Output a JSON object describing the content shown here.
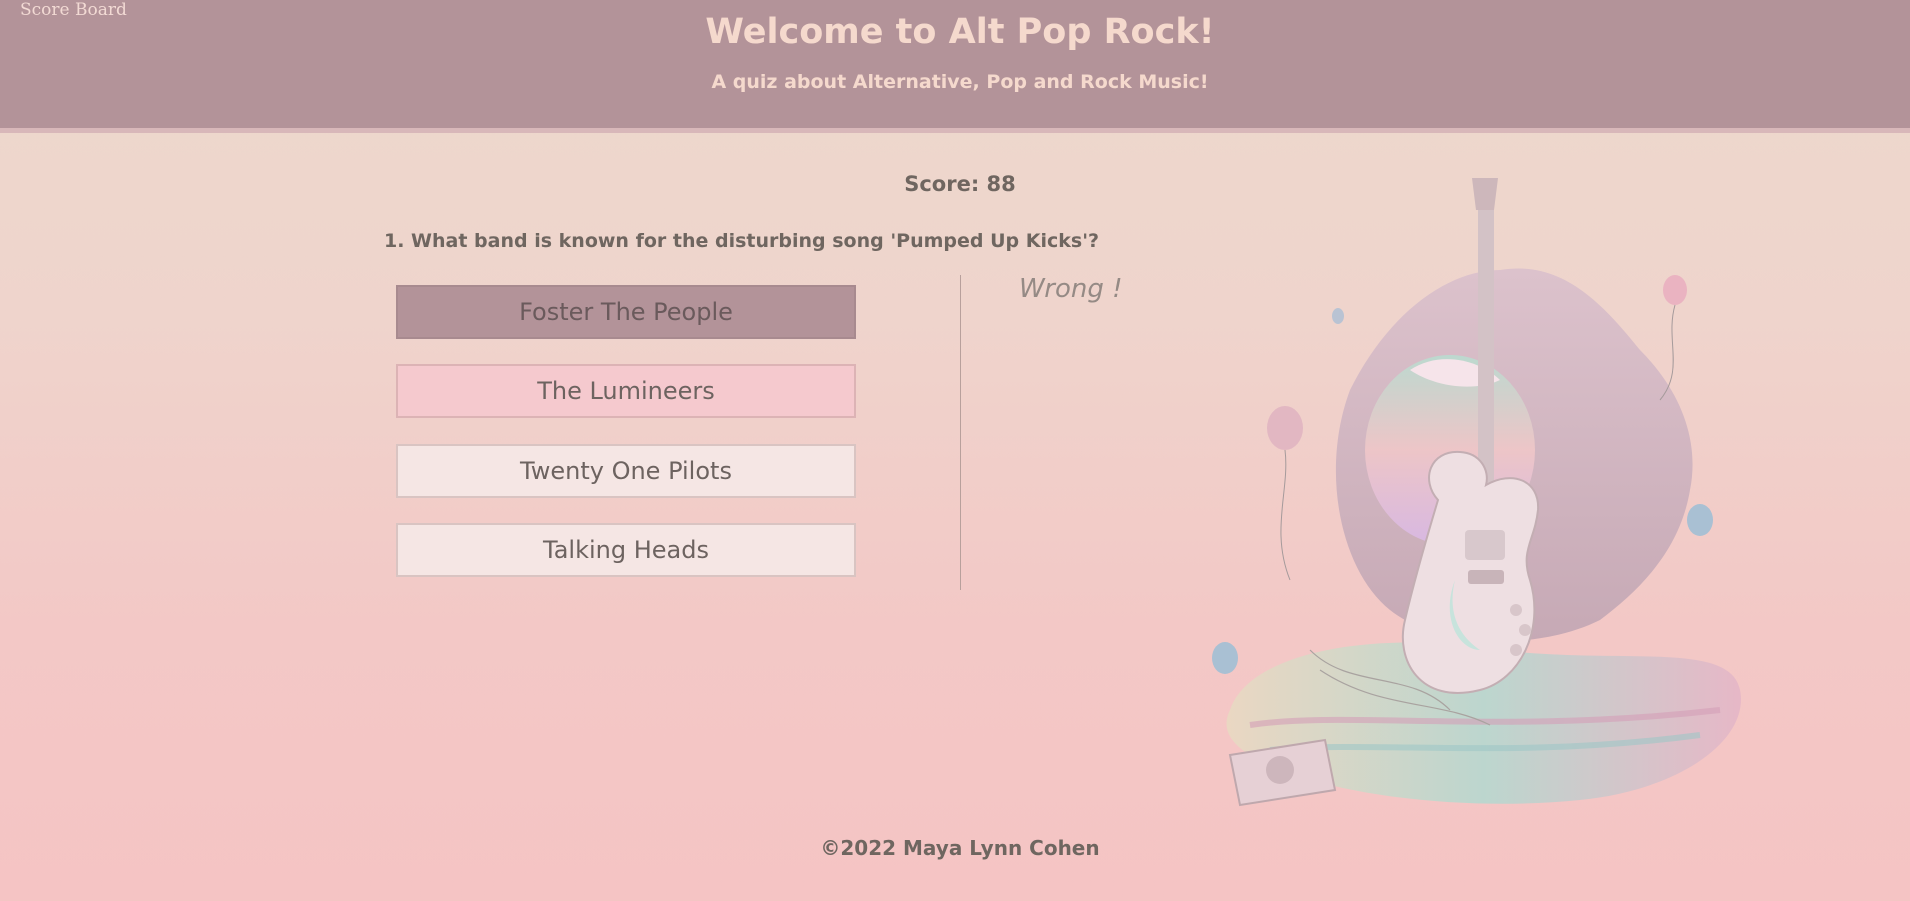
{
  "header": {
    "scoreboard_link": "Score Board",
    "title": "Welcome to Alt Pop Rock!",
    "subtitle": "A quiz about Alternative, Pop and Rock Music!"
  },
  "quiz": {
    "score_text": "Score: 88",
    "question": "1. What band is known for the disturbing song 'Pumped Up Kicks'?",
    "answers": [
      {
        "label": "Foster The People",
        "state": "hovered"
      },
      {
        "label": "The Lumineers",
        "state": "selected-wrong"
      },
      {
        "label": "Twenty One Pilots",
        "state": "default"
      },
      {
        "label": "Talking Heads",
        "state": "default"
      }
    ],
    "feedback": "Wrong !"
  },
  "illustration": {
    "icon": "guitar-balloons-illustration"
  },
  "footer": {
    "copyright": "©2022 Maya Lynn Cohen"
  },
  "colors": {
    "header_bg": "#b39399",
    "header_text": "#f5d9cd",
    "body_text": "#6f6660",
    "answer_hover": "#b39399",
    "answer_wrong": "#f5c9ce",
    "answer_default": "#f5e6e4"
  }
}
